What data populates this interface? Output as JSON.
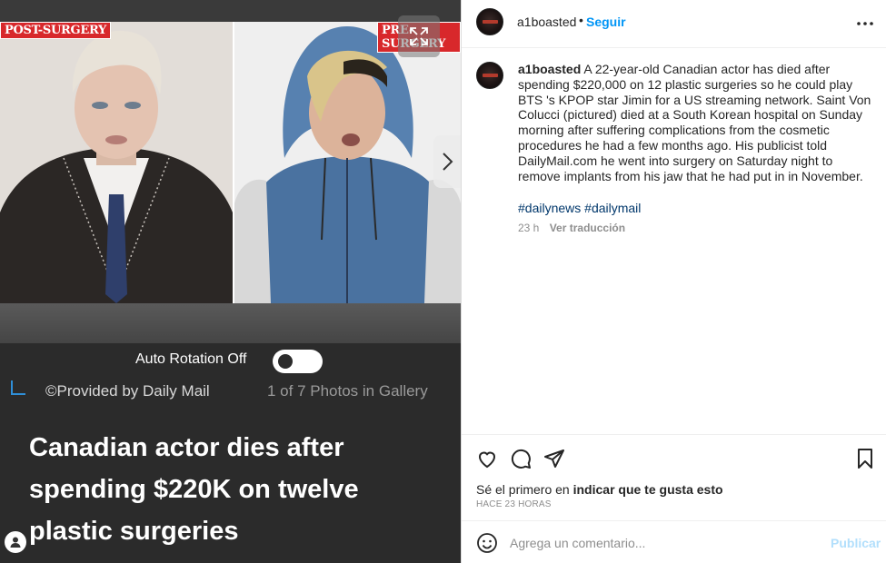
{
  "media": {
    "stamp_left": "POST-SURGERY",
    "stamp_right": "PRE-SURGERY",
    "auto_rotation_label": "Auto Rotation Off",
    "provided_by": "©Provided by Daily Mail",
    "gallery_count": "1 of 7 Photos in Gallery",
    "headline": "Canadian actor dies after spending $220K on twelve plastic surgeries"
  },
  "post": {
    "username": "a1boasted",
    "separator": "•",
    "follow_label": "Seguir",
    "caption_text": " A 22-year-old Canadian actor has died after spending $220,000 on 12 plastic surgeries so he could play BTS 's KPOP star Jimin for a US streaming network. Saint Von Colucci (pictured) died at a South Korean hospital on Sunday morning after suffering complications from the cosmetic procedures he had a few months ago. His publicist told DailyMail.com he went into surgery on Saturday night to remove implants from his jaw that he had put in in November.",
    "hashtags": "#dailynews #dailymail",
    "time": "23 h",
    "translate_label": "Ver traducción",
    "likes_prefix": "Sé el primero en ",
    "likes_link": "indicar que te gusta esto",
    "time_ago": "HACE 23 HORAS",
    "comment_placeholder": "Agrega un comentario...",
    "publish_label": "Publicar"
  },
  "icons": {
    "expand": "expand-icon",
    "next": "chevron-right-icon",
    "more": "more-horizontal-icon",
    "like": "heart-icon",
    "comment": "comment-icon",
    "share": "send-icon",
    "save": "bookmark-icon",
    "emoji": "emoji-icon",
    "user": "user-icon"
  },
  "colors": {
    "accent": "#0095f6",
    "stamp_red": "#d8282b",
    "link_blue": "#2f8fd8"
  }
}
